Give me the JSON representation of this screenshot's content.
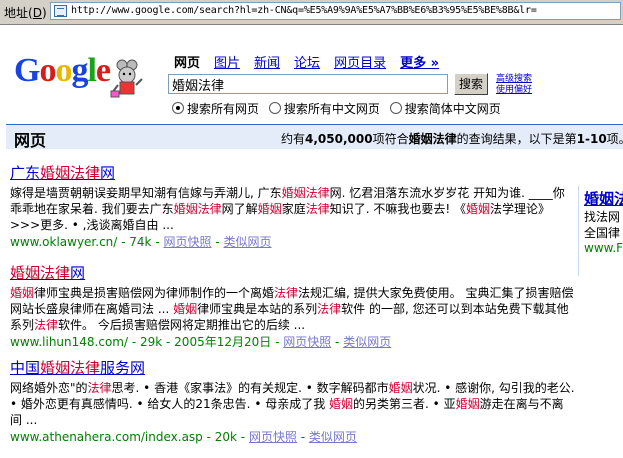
{
  "address_bar": {
    "label": "地址",
    "shortcut": "D",
    "url": "http://www.google.com/search?hl=zh-CN&q=%E5%A9%9A%E5%A7%BB%E6%B3%95%E5%BE%8B&lr="
  },
  "logo": "Google",
  "tabs": [
    "网页",
    "图片",
    "新闻",
    "论坛",
    "网页目录",
    "更多 »"
  ],
  "search": {
    "value": "婚姻法律",
    "button": "搜索",
    "advanced": "高级搜索",
    "preferences": "使用偏好"
  },
  "radios": [
    {
      "label": "搜索所有网页",
      "selected": true
    },
    {
      "label": "搜索所有中文网页",
      "selected": false
    },
    {
      "label": "搜索简体中文网页",
      "selected": false
    }
  ],
  "result_bar": {
    "title": "网页",
    "stats_prefix": "约有",
    "count": "4,050,000",
    "stats_mid": "项符合",
    "query": "婚姻法律",
    "stats_suffix": "的查询结果，以下是第",
    "range": "1-10",
    "range_suffix": "项。"
  },
  "results": [
    {
      "title_pre": "广东",
      "title_hl": "婚姻法律",
      "title_post": "网",
      "snippet": [
        {
          "t": "嫁得是墙贾朝朝误妾期早知潮有信嫁与弄潮儿, 广东"
        },
        {
          "h": "婚姻法律"
        },
        {
          "t": "网. 忆君泪落东流水岁岁花  开知为谁. ____你乖乖地在家呆着. 我们要去广东"
        },
        {
          "h": "婚姻法律"
        },
        {
          "t": "网了解"
        },
        {
          "h": "婚姻"
        },
        {
          "t": "家庭"
        },
        {
          "h": "法律"
        },
        {
          "t": "知识了. 不嘛我也要去!  《"
        },
        {
          "h": "婚姻"
        },
        {
          "t": "法学理论》  >>>更多. • ,浅谈离婚自由  ..."
        }
      ],
      "url": "www.oklawyer.cn/ - 74k",
      "cache": "网页快照",
      "similar": "类似网页"
    },
    {
      "title_pre": "",
      "title_hl": "婚姻法律",
      "title_post": "网",
      "snippet": [
        {
          "h": "婚姻"
        },
        {
          "t": "律师宝典是损害赔偿网为律师制作的一个离婚"
        },
        {
          "h": "法律"
        },
        {
          "t": "法规汇编, 提供大家免费使用。  宝典汇集了损害赔偿网站长盛泉律师在离婚司法  ... "
        },
        {
          "h": "婚姻"
        },
        {
          "t": "律师宝典是本站的系列"
        },
        {
          "h": "法律"
        },
        {
          "t": "软件  的一部, 您还可以到本站免费下载其他系列"
        },
        {
          "h": "法律"
        },
        {
          "t": "软件。 今后损害赔偿网将定期推出它的后续  ..."
        }
      ],
      "url": "www.lihun148.com/ - 29k - 2005年12月20日",
      "cache": "网页快照",
      "similar": "类似网页"
    },
    {
      "title_pre": "中国",
      "title_hl": "婚姻法律",
      "title_post": "服务网",
      "snippet": [
        {
          "t": "网络婚外恋\"的"
        },
        {
          "h": "法律"
        },
        {
          "t": "思考. • 香港《家事法》的有关规定. • 数字解码都市"
        },
        {
          "h": "婚姻"
        },
        {
          "t": "状况. • 感谢你, 勾引我的老公. • 婚外恋更有真感情吗. • 给女人的21条忠告. • 母亲成了我 "
        },
        {
          "h": "婚姻"
        },
        {
          "t": "的另类第三者. • 亚"
        },
        {
          "h": "婚姻"
        },
        {
          "t": "游走在离与不离间  ..."
        }
      ],
      "url": "www.athenahera.com/index.asp - 20k",
      "cache": "网页快照",
      "similar": "类似网页"
    }
  ],
  "ad": {
    "title": "婚姻法",
    "line1": "找法网",
    "line2": "全国律",
    "url": "www.F"
  }
}
